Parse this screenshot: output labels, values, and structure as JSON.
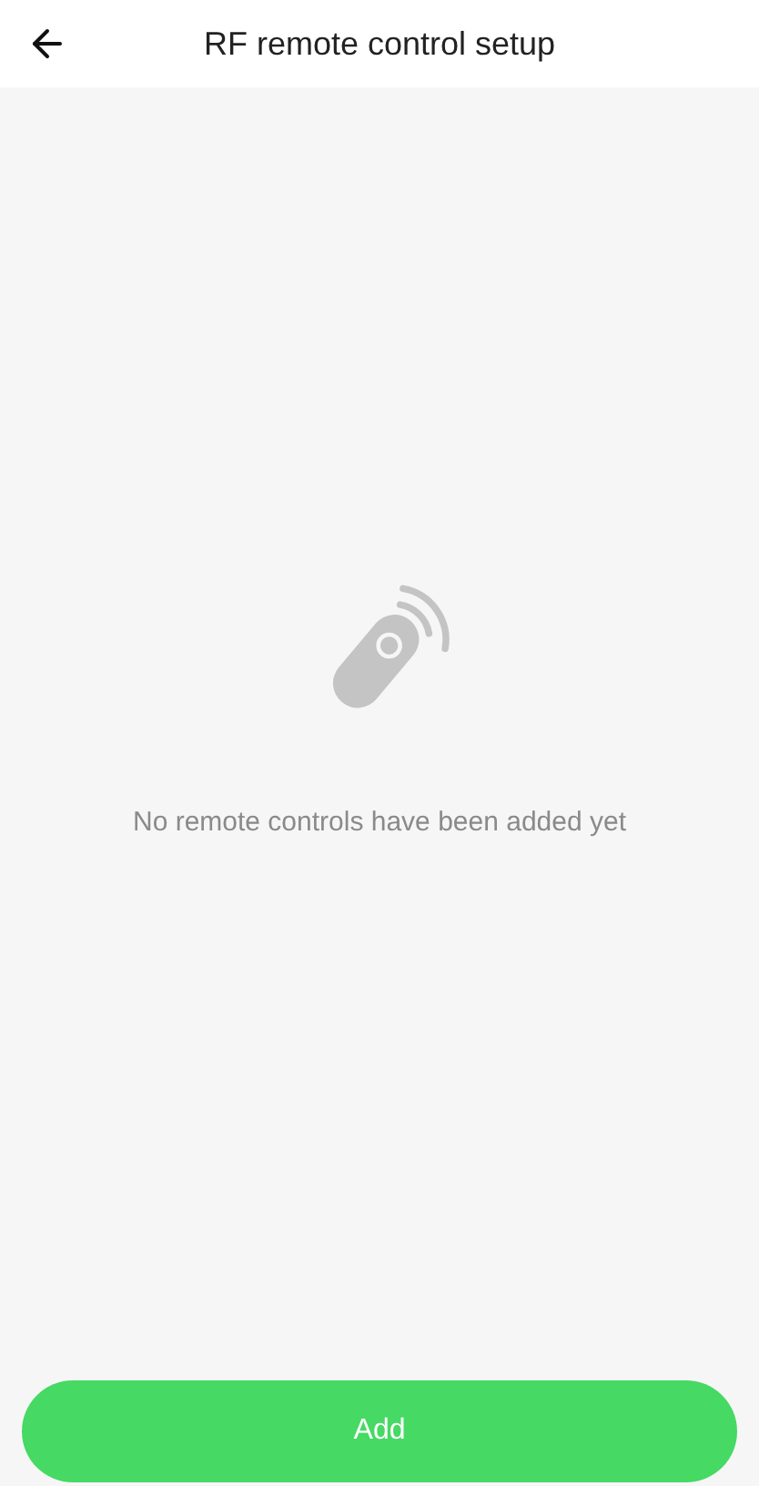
{
  "header": {
    "title": "RF remote control setup"
  },
  "empty_state": {
    "message": "No remote controls have been added yet"
  },
  "add_button": {
    "label": "Add"
  }
}
